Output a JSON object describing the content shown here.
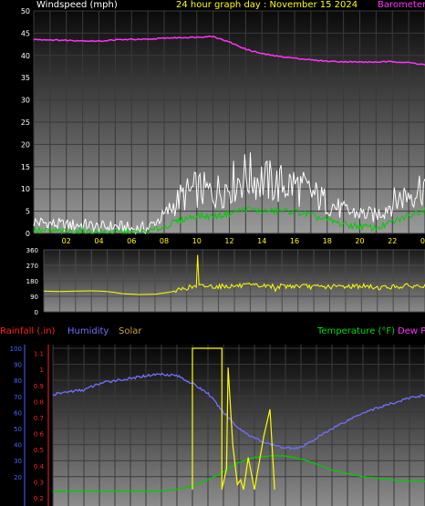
{
  "header": {
    "left_label": "Windspeed (mph)",
    "center_label": "24 hour graph day : November 15 2024",
    "right_label": "Barometer"
  },
  "lower_header": {
    "rainfall_label": "Rainfall (.in)",
    "humidity_label": "Humidity",
    "solar_label": "Solar",
    "temperature_label": "Temperature (°F)",
    "dewpoint_label": "Dew P"
  },
  "colors": {
    "wind_avg": "#00cc00",
    "wind_gust": "#ffffff",
    "barometer": "#ff33ff",
    "wind_dir": "#ffff00",
    "humidity": "#7070ff",
    "solar": "#ffff00",
    "temperature": "#00cc00",
    "rain_axis": "#ff2020",
    "humidity_axis": "#4466ff"
  },
  "chart_data": [
    {
      "type": "line",
      "ylabel": "Windspeed (mph)",
      "title": "24 hour graph day : November 15 2024",
      "x_ticks": [
        "02",
        "04",
        "06",
        "08",
        "10",
        "12",
        "14",
        "16",
        "18",
        "20",
        "22",
        "00"
      ],
      "xlim": [
        0,
        24
      ],
      "ylim": [
        0,
        50
      ],
      "y_ticks": [
        0,
        5,
        10,
        15,
        20,
        25,
        30,
        35,
        40,
        45,
        50
      ],
      "grid": true,
      "series": [
        {
          "name": "Barometer",
          "role": "barometer",
          "x": [
            0,
            1,
            2,
            3,
            4,
            5,
            6,
            7,
            8,
            9,
            10,
            11,
            12,
            13,
            14,
            15,
            16,
            17,
            18,
            19,
            20,
            21,
            22,
            23,
            24
          ],
          "y": [
            43.6,
            43.5,
            43.4,
            43.3,
            43.2,
            43.5,
            43.6,
            43.6,
            43.9,
            44.0,
            44.1,
            44.3,
            43.0,
            41.4,
            40.4,
            39.8,
            39.4,
            39.0,
            38.7,
            38.6,
            38.5,
            38.5,
            38.6,
            38.4,
            37.9
          ]
        },
        {
          "name": "Windspeed gust",
          "role": "gust",
          "x": [
            0,
            1,
            2,
            3,
            4,
            5,
            6,
            7,
            8,
            9,
            10,
            11,
            12,
            13,
            14,
            15,
            16,
            17,
            18,
            19,
            20,
            21,
            22,
            23,
            24
          ],
          "y": [
            2.6,
            2.2,
            1.8,
            2.0,
            1.3,
            1.6,
            1.0,
            1.2,
            4.0,
            8.0,
            10.0,
            9.0,
            11.0,
            13.0,
            12.0,
            11.0,
            11.0,
            9.0,
            7.0,
            5.0,
            4.5,
            4.0,
            7.0,
            9.0,
            11.0
          ]
        },
        {
          "name": "Windspeed average",
          "role": "avg",
          "x": [
            0,
            1,
            2,
            3,
            4,
            5,
            6,
            7,
            8,
            9,
            10,
            11,
            12,
            13,
            14,
            15,
            16,
            17,
            18,
            19,
            20,
            21,
            22,
            23,
            24
          ],
          "y": [
            0.6,
            0.5,
            0.4,
            0.5,
            0.3,
            0.3,
            0.2,
            0.3,
            1.5,
            3.0,
            4.0,
            3.8,
            4.5,
            5.5,
            5.0,
            5.0,
            5.0,
            4.0,
            3.0,
            2.0,
            1.6,
            1.2,
            2.5,
            4.0,
            5.5
          ]
        }
      ]
    },
    {
      "type": "line",
      "ylim": [
        0,
        360
      ],
      "y_ticks": [
        0,
        90,
        180,
        270,
        360
      ],
      "xlim": [
        0,
        24
      ],
      "grid": true,
      "series": [
        {
          "name": "Wind direction",
          "role": "dir",
          "x": [
            0,
            1,
            2,
            3,
            4,
            5,
            6,
            7,
            8,
            9,
            10,
            11,
            12,
            13,
            14,
            15,
            16,
            17,
            18,
            19,
            20,
            21,
            22,
            23,
            24
          ],
          "y": [
            120,
            118,
            120,
            122,
            118,
            105,
            100,
            102,
            115,
            140,
            150,
            148,
            150,
            152,
            150,
            148,
            150,
            145,
            145,
            148,
            150,
            140,
            145,
            150,
            148
          ]
        }
      ]
    },
    {
      "type": "line",
      "ylim": [
        0,
        100
      ],
      "y_ticks_humidity": [
        20,
        30,
        40,
        50,
        60,
        70,
        80,
        90,
        100
      ],
      "y_ticks_rain": [
        "0.2",
        "0.3",
        "0.4",
        "0.5",
        "0.6",
        "0.7",
        "0.8",
        "0.9",
        "1",
        "1.1"
      ],
      "xlim": [
        0,
        24
      ],
      "grid": true,
      "series": [
        {
          "name": "Humidity",
          "role": "humidity",
          "x": [
            0,
            1,
            2,
            3,
            4,
            5,
            6,
            7,
            8,
            9,
            10,
            11,
            12,
            13,
            14,
            15,
            16,
            17,
            18,
            19,
            20,
            21,
            22,
            23,
            24
          ],
          "y": [
            71,
            73,
            74,
            78,
            80,
            81,
            83,
            84,
            83,
            78,
            72,
            60,
            50,
            44,
            40,
            38,
            38,
            44,
            50,
            55,
            60,
            63,
            66,
            69,
            71
          ]
        },
        {
          "name": "Temperature",
          "role": "temperature",
          "x": [
            0,
            1,
            2,
            3,
            4,
            5,
            6,
            7,
            8,
            9,
            10,
            11,
            12,
            13,
            14,
            15,
            16,
            17,
            18,
            19,
            20,
            21,
            22,
            23,
            24
          ],
          "y": [
            11,
            11,
            11,
            11,
            11,
            11,
            11,
            11,
            12,
            14,
            18,
            23,
            29,
            32,
            33,
            33,
            31,
            28,
            24,
            22,
            20,
            19,
            18,
            17,
            17
          ]
        },
        {
          "name": "Solar",
          "role": "solar",
          "x": [
            9.0,
            9.0,
            10.9,
            10.9,
            11.2,
            11.3,
            11.6,
            11.9,
            12.1,
            12.3,
            12.6,
            13.0,
            13.6,
            14.0,
            14.3
          ],
          "y": [
            12,
            100,
            100,
            12,
            25,
            88,
            40,
            15,
            18,
            12,
            32,
            12,
            45,
            62,
            12
          ]
        }
      ]
    }
  ]
}
